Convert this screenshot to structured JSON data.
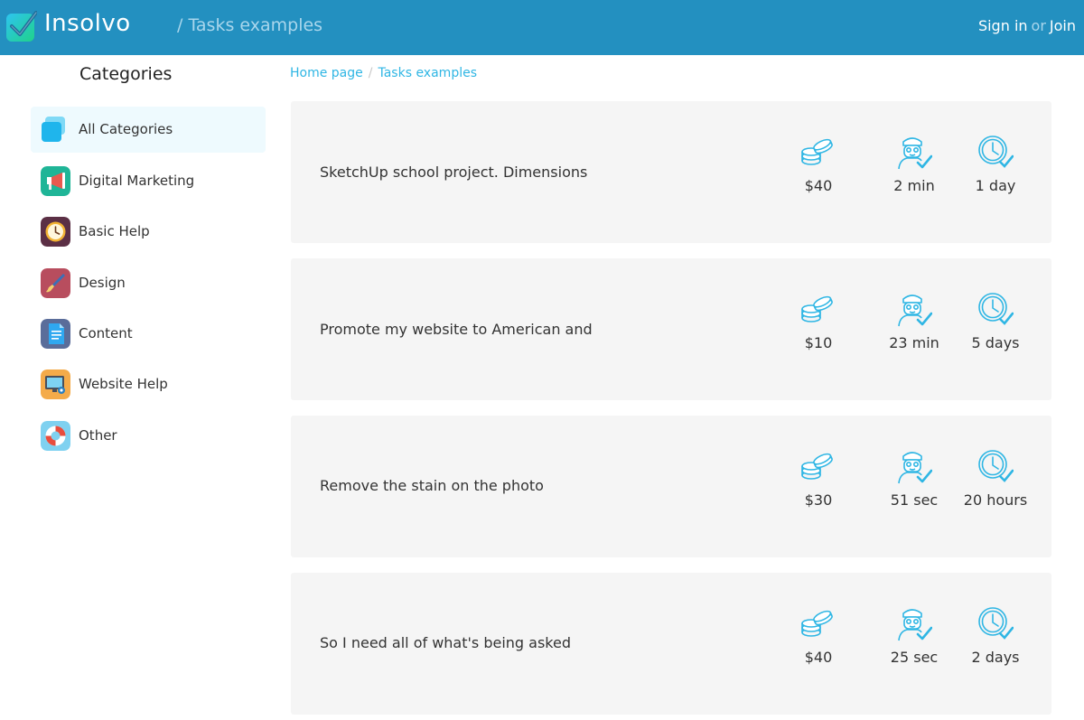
{
  "header": {
    "brand": "Insolvo",
    "page_title": "/ Tasks examples",
    "sign_in": "Sign in",
    "or": "or",
    "join": "Join"
  },
  "sidebar": {
    "title": "Categories",
    "items": [
      {
        "label": "All Categories",
        "icon": "all-categories-icon",
        "active": true
      },
      {
        "label": "Digital Marketing",
        "icon": "megaphone-icon"
      },
      {
        "label": "Basic Help",
        "icon": "clock-icon"
      },
      {
        "label": "Design",
        "icon": "paintbrush-icon"
      },
      {
        "label": "Content",
        "icon": "document-icon"
      },
      {
        "label": "Website Help",
        "icon": "monitor-icon"
      },
      {
        "label": "Other",
        "icon": "lifebuoy-icon"
      }
    ]
  },
  "breadcrumb": {
    "home": "Home page",
    "current": "Tasks examples"
  },
  "tasks": [
    {
      "title": "SketchUp school project. Dimensions",
      "price": "$40",
      "response": "2 min",
      "duration": "1 day"
    },
    {
      "title": "Promote my website to American and",
      "price": "$10",
      "response": "23 min",
      "duration": "5 days"
    },
    {
      "title": "Remove the stain on the photo",
      "price": "$30",
      "response": "51 sec",
      "duration": "20 hours"
    },
    {
      "title": "So I need all of what's being asked",
      "price": "$40",
      "response": "25 sec",
      "duration": "2 days"
    }
  ],
  "colors": {
    "header_bg": "#2390c0",
    "accent": "#2fb6e4",
    "card_bg": "#f5f5f5",
    "active_item_bg": "#eefafe"
  }
}
